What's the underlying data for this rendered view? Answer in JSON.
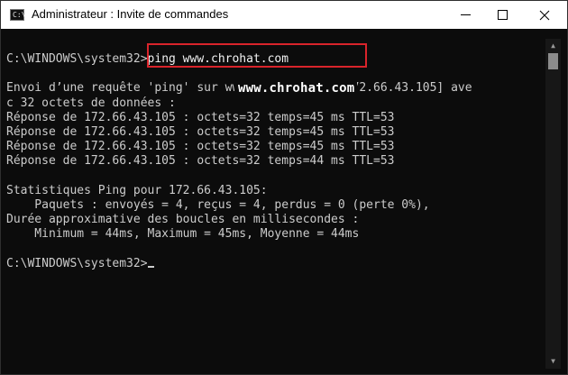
{
  "window": {
    "title": "Administrateur : Invite de commandes",
    "icon": "cmd-icon",
    "icon_glyph": "C:\\"
  },
  "console": {
    "lines": [
      "C:\\WINDOWS\\system32>ping www.chrohat.com",
      "",
      "Envoi d’une requête 'ping' sur www.chrohat.com [172.66.43.105] ave",
      "c 32 octets de données :",
      "Réponse de 172.66.43.105 : octets=32 temps=45 ms TTL=53",
      "Réponse de 172.66.43.105 : octets=32 temps=45 ms TTL=53",
      "Réponse de 172.66.43.105 : octets=32 temps=45 ms TTL=53",
      "Réponse de 172.66.43.105 : octets=32 temps=44 ms TTL=53",
      "",
      "Statistiques Ping pour 172.66.43.105:",
      "    Paquets : envoyés = 4, reçus = 4, perdus = 0 (perte 0%),",
      "Durée approximative des boucles en millisecondes :",
      "    Minimum = 44ms, Maximum = 45ms, Moyenne = 44ms",
      "",
      "C:\\WINDOWS\\system32>"
    ],
    "prompt": "C:\\WINDOWS\\system32>",
    "command": "ping www.chrohat.com",
    "watermark": "www.chrohat.com"
  },
  "colors": {
    "background": "#0c0c0c",
    "text": "#cccccc",
    "highlight_border": "#d9242b"
  }
}
